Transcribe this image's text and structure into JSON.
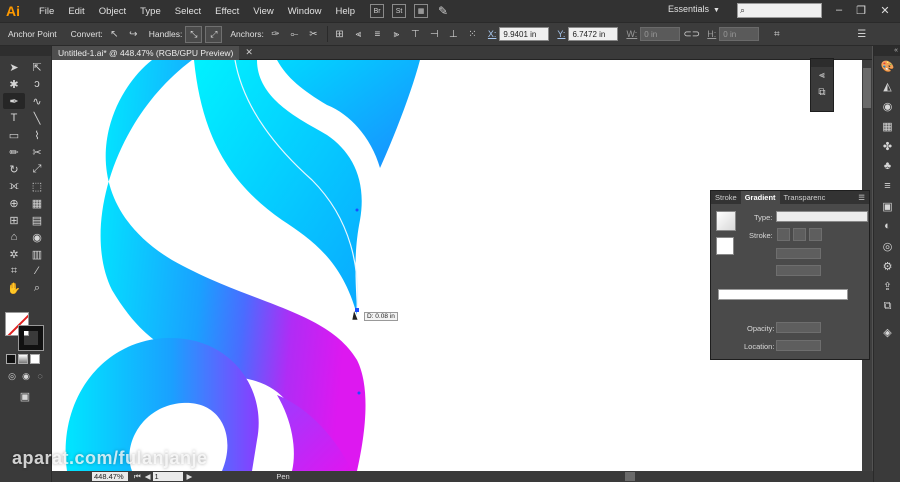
{
  "app": {
    "logo": "Ai"
  },
  "menu": [
    "File",
    "Edit",
    "Object",
    "Type",
    "Select",
    "Effect",
    "View",
    "Window",
    "Help"
  ],
  "menubar_icons": {
    "bridge": "Br",
    "stock": "St"
  },
  "workspace": {
    "label": "Essentials"
  },
  "control_bar": {
    "tool_label": "Anchor Point",
    "convert_label": "Convert:",
    "handles_label": "Handles:",
    "anchors_label": "Anchors:",
    "x_label": "X:",
    "x_value": "9.9401 in",
    "y_label": "Y:",
    "y_value": "6.7472 in",
    "w_label": "W:",
    "w_value": "0 in",
    "h_label": "H:",
    "h_value": "0 in"
  },
  "document": {
    "tab_title": "Untitled-1.ai* @ 448.47% (RGB/GPU Preview)"
  },
  "canvas": {
    "distance_tooltip": "D: 0.08 in"
  },
  "gradient_panel": {
    "tabs": [
      "Stroke",
      "Gradient",
      "Transparenc"
    ],
    "type_label": "Type:",
    "stroke_label": "Stroke:",
    "opacity_label": "Opacity:",
    "location_label": "Location:"
  },
  "status_bar": {
    "zoom": "448.47%",
    "artboard": "1",
    "current_tool": "Pen"
  },
  "watermark": "aparat.com/fulanjanje",
  "colors": {
    "cyan": "#00e5ff",
    "blue": "#1e90ff",
    "magenta": "#d41cf0",
    "accent_orange": "#ff9a00"
  }
}
